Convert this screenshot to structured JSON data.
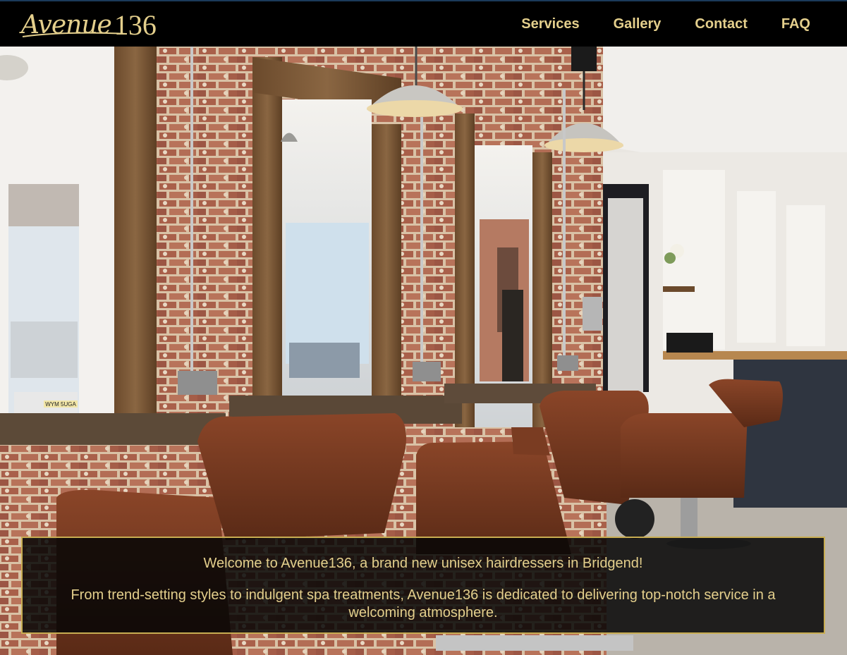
{
  "site": {
    "logo_script": "Avenue",
    "logo_number": "136"
  },
  "nav": {
    "services": "Services",
    "gallery": "Gallery",
    "contact": "Contact",
    "faq": "FAQ"
  },
  "welcome": {
    "line1": "Welcome to Avenue136, a brand new unisex hairdressers in Bridgend!",
    "line2": "From trend-setting styles to indulgent spa treatments, Avenue136 is dedicated to delivering top-notch service in a welcoming atmosphere."
  },
  "photo": {
    "plate_text": "WYM 5UGA"
  },
  "colors": {
    "accent_gold": "#e4cf8c",
    "border_gold": "#c8ad52",
    "header_bg": "#000000"
  }
}
